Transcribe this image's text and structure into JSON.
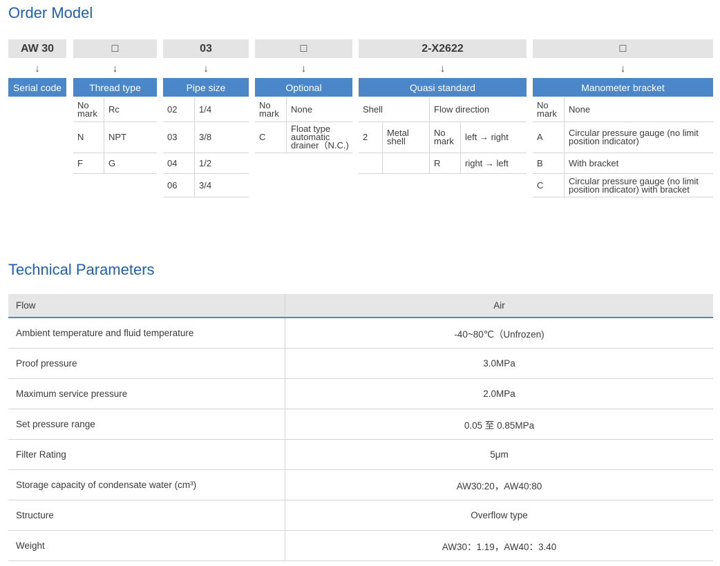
{
  "order_model": {
    "title": "Order Model",
    "codes": [
      "AW 30",
      "□",
      "03",
      "□",
      "2-X2622",
      "□"
    ],
    "arrow": "↓",
    "headers": [
      "Serial code",
      "Thread type",
      "Pipe size",
      "Optional",
      "Quasi standard",
      "Manometer bracket"
    ],
    "thread_type": [
      {
        "code": "No mark",
        "value": "Rc"
      },
      {
        "code": "N",
        "value": "NPT"
      },
      {
        "code": "F",
        "value": "G"
      }
    ],
    "pipe_size": [
      {
        "code": "02",
        "value": "1/4"
      },
      {
        "code": "03",
        "value": "3/8"
      },
      {
        "code": "04",
        "value": "1/2"
      },
      {
        "code": "06",
        "value": "3/4"
      }
    ],
    "optional": [
      {
        "code": "No mark",
        "value": "None"
      },
      {
        "code": "C",
        "value": "Float type automatic drainer（N.C.)"
      }
    ],
    "quasi_standard": {
      "shell_label": "Shell",
      "flow_label": "Flow direction",
      "shell_code": "2",
      "shell_value": "Metal shell",
      "flows": [
        {
          "code": "No mark",
          "value": "left → right"
        },
        {
          "code": "R",
          "value": "right → left"
        }
      ]
    },
    "manometer": [
      {
        "code": "No mark",
        "value": "None"
      },
      {
        "code": "A",
        "value": "Circular pressure gauge (no limit position indicator)"
      },
      {
        "code": "B",
        "value": "With bracket"
      },
      {
        "code": "C",
        "value": "Circular pressure gauge (no limit position indicator) with bracket"
      }
    ]
  },
  "technical": {
    "title": "Technical Parameters",
    "header": {
      "label": "Flow",
      "value": "Air"
    },
    "rows": [
      {
        "label": "Ambient temperature and fluid temperature",
        "value": "-40~80℃（Unfrozen)"
      },
      {
        "label": "Proof pressure",
        "value": "3.0MPa"
      },
      {
        "label": "Maximum service pressure",
        "value": "2.0MPa"
      },
      {
        "label": "Set pressure range",
        "value": "0.05 至 0.85MPa"
      },
      {
        "label": "Filter Rating",
        "value": "5μm"
      },
      {
        "label": "Storage capacity of condensate water (cm³)",
        "value": "AW30:20，AW40:80"
      },
      {
        "label": "Structure",
        "value": "Overflow type"
      },
      {
        "label": "Weight",
        "value": "AW30：1.19，AW40：3.40"
      }
    ]
  }
}
